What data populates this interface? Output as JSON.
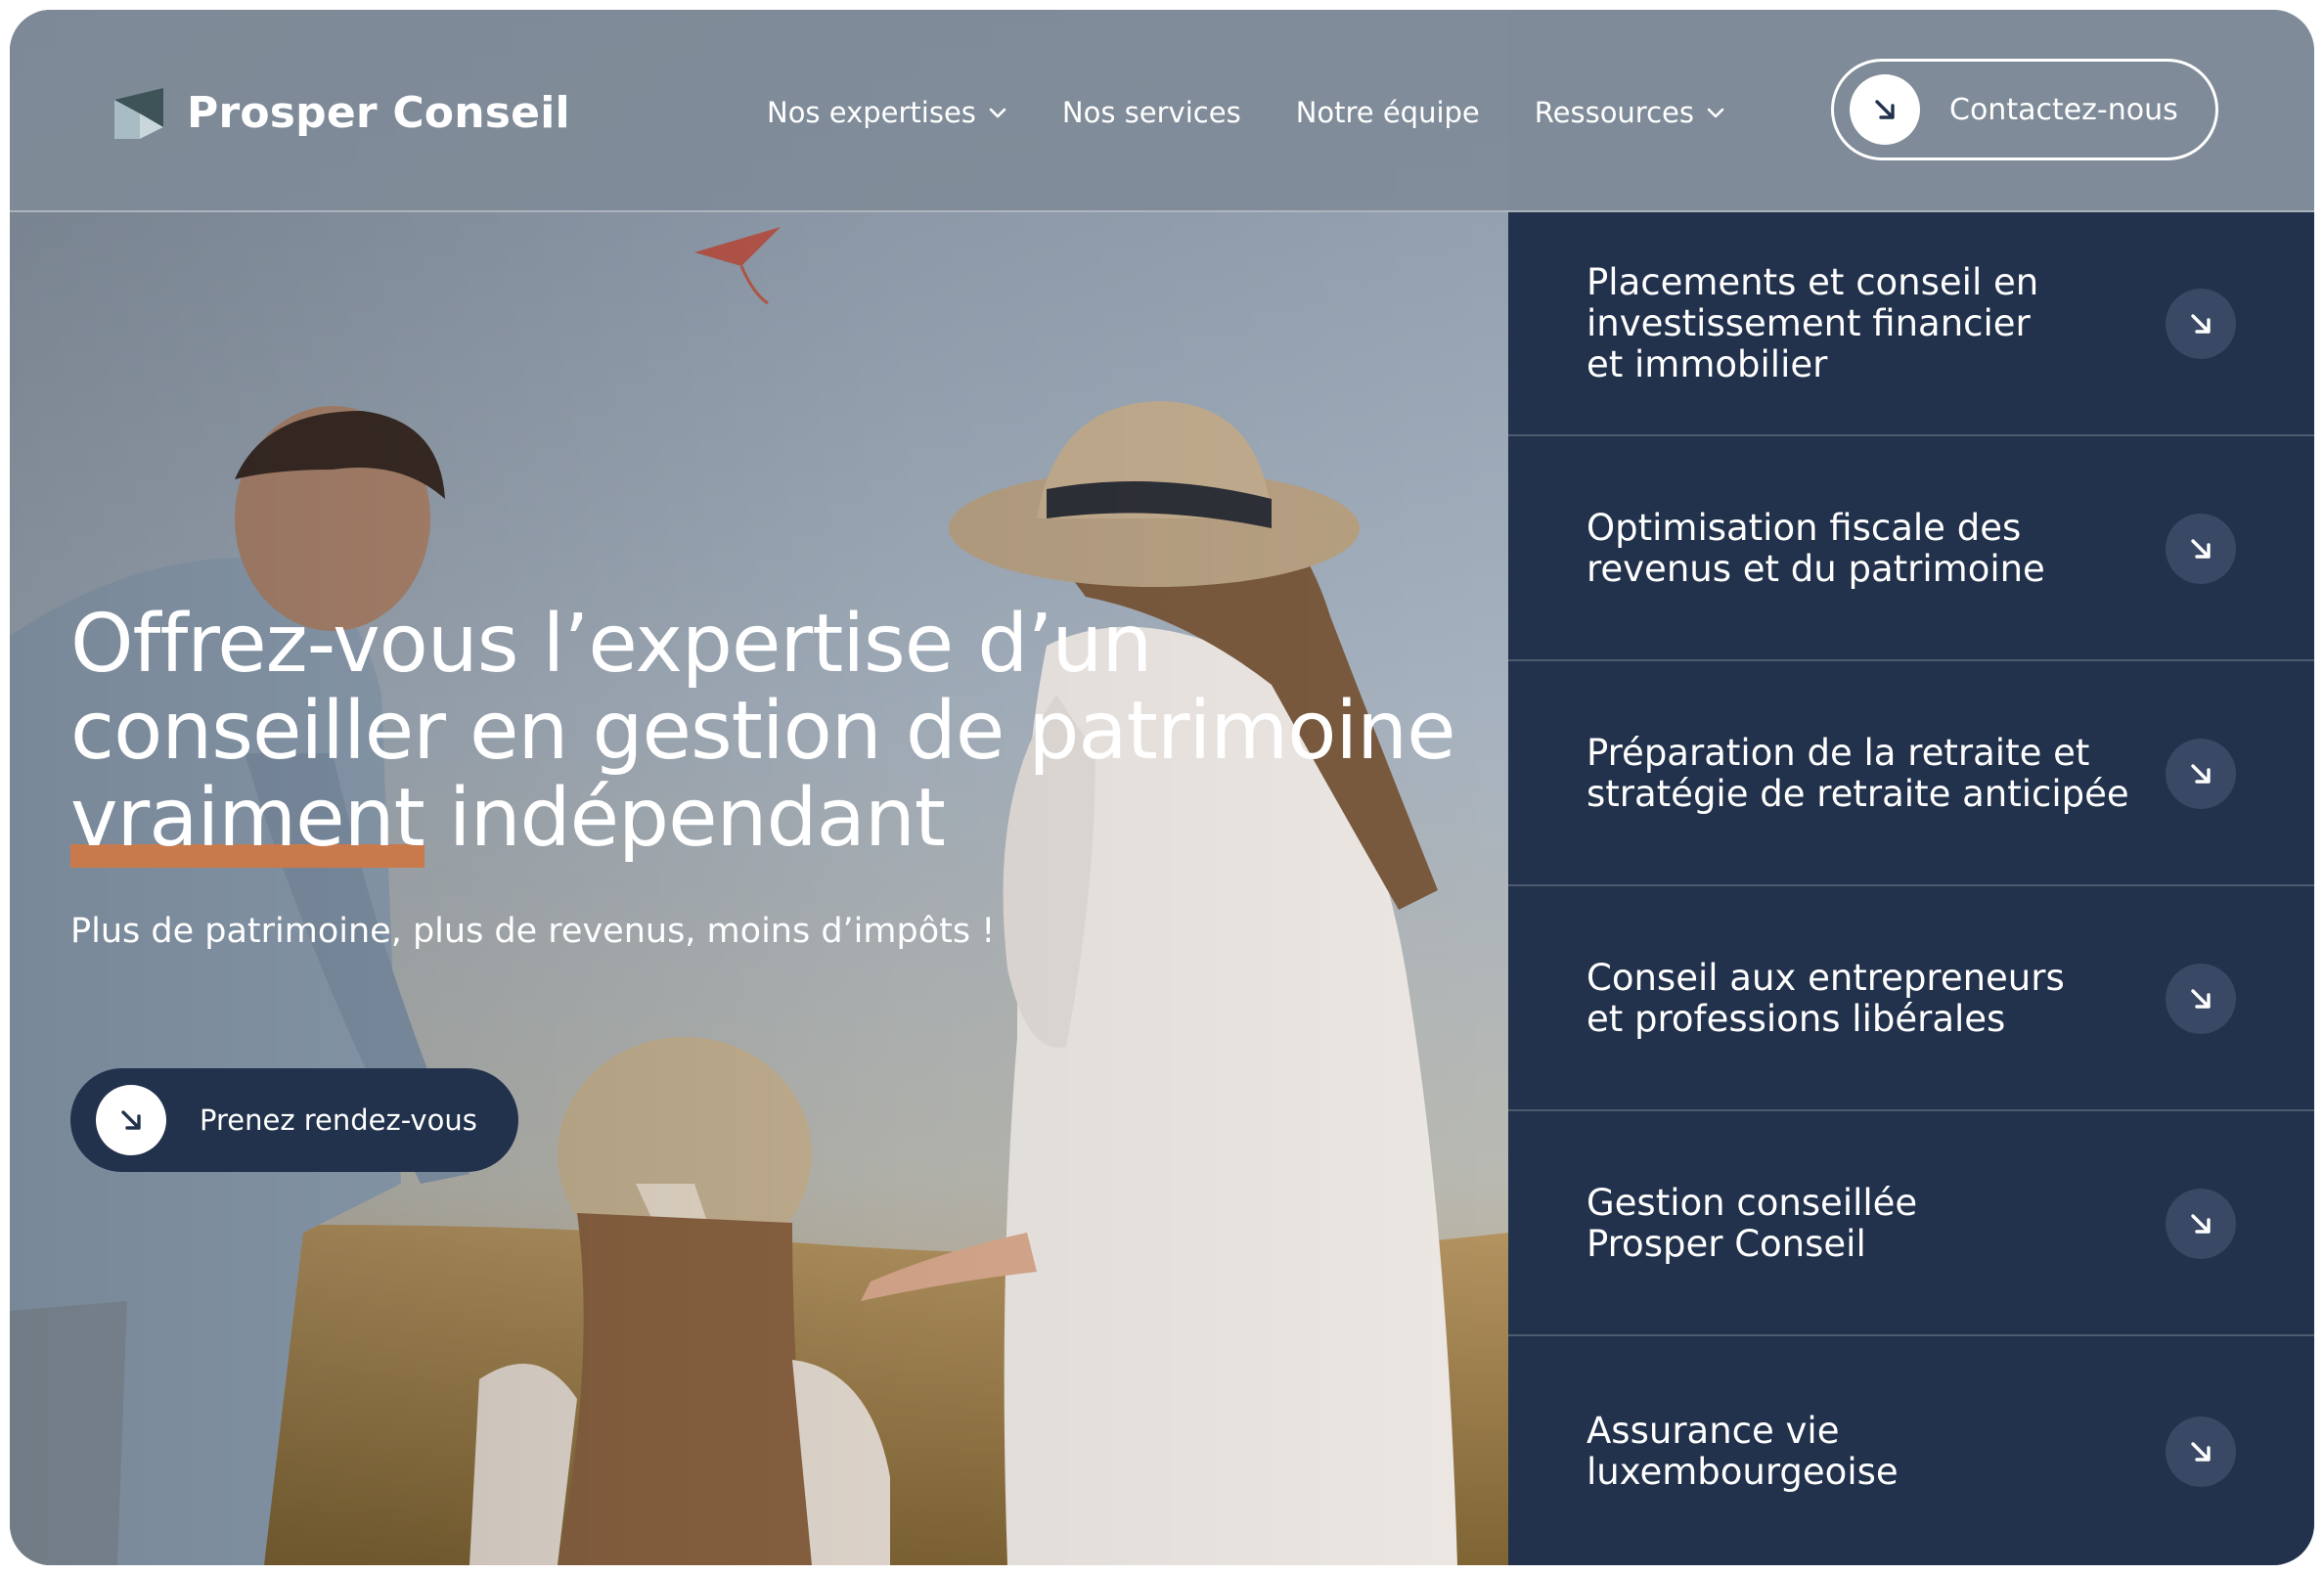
{
  "header": {
    "brand_name": "Prosper Conseil",
    "nav": [
      {
        "label": "Nos expertises",
        "dropdown": true
      },
      {
        "label": "Nos services",
        "dropdown": false
      },
      {
        "label": "Notre équipe",
        "dropdown": false
      },
      {
        "label": "Ressources",
        "dropdown": true
      }
    ],
    "contact_label": "Contactez-nous"
  },
  "hero": {
    "title_line1": "Offrez-vous l’expertise d’un",
    "title_line2": "conseiller en gestion de patrimoine",
    "title_highlight": "vraiment",
    "title_line3_rest": " indépendant",
    "subtitle": "Plus de patrimoine, plus de revenus, moins d’impôts !",
    "cta_label": "Prenez rendez-vous"
  },
  "panel": {
    "items": [
      {
        "label": "Placements et conseil en\ninvestissement financier\net immobilier"
      },
      {
        "label": "Optimisation fiscale des\nrevenus et du patrimoine"
      },
      {
        "label": "Préparation de la retraite et\nstratégie de retraite anticipée"
      },
      {
        "label": "Conseil aux entrepreneurs\net professions libérales"
      },
      {
        "label": "Gestion conseillée\nProsper Conseil"
      },
      {
        "label": "Assurance vie luxembourgeoise"
      }
    ]
  },
  "colors": {
    "navy": "#22324c",
    "accent": "#c97a4c",
    "header_overlay": "#808b98",
    "arrow_circle": "#394864"
  },
  "icons": {
    "logo": "logo-mark-icon",
    "arrow": "arrow-down-right-icon",
    "chevron": "chevron-down-icon"
  }
}
